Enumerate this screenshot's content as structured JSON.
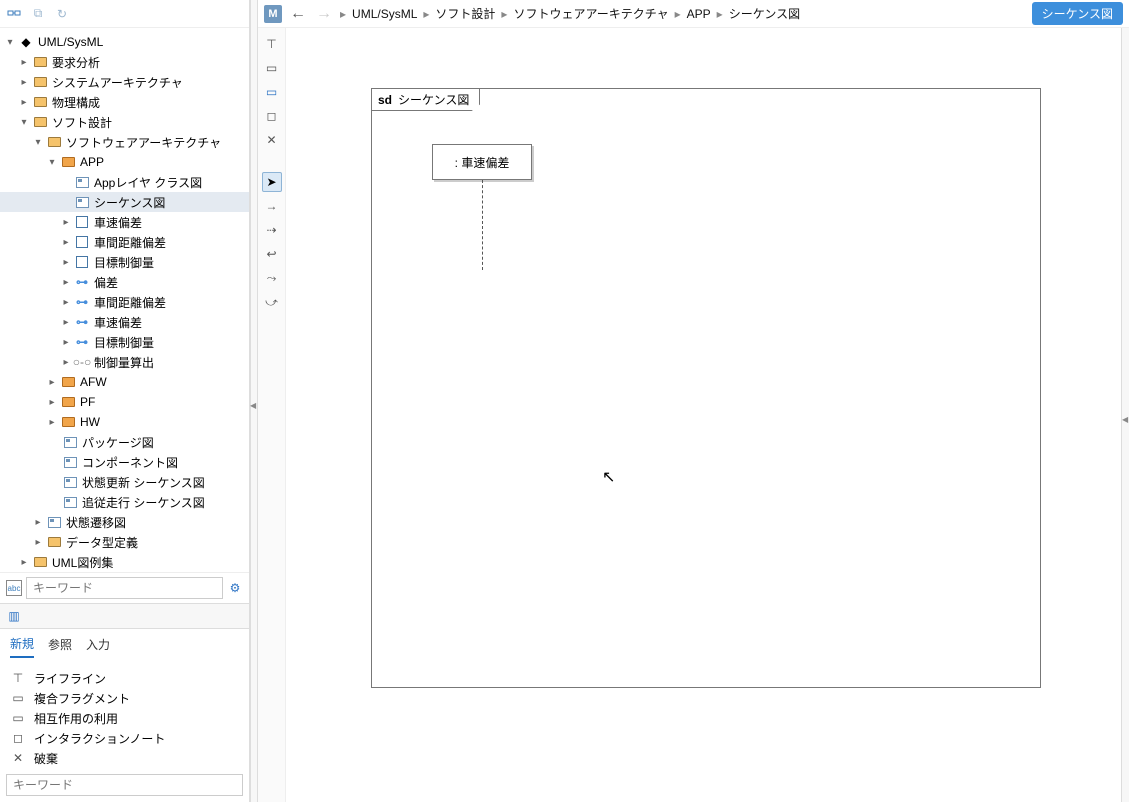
{
  "toolbar": {
    "model_badge": "M"
  },
  "breadcrumb": {
    "items": [
      "UML/SysML",
      "ソフト設計",
      "ソフトウェアアーキテクチャ",
      "APP",
      "シーケンス図"
    ],
    "chip": "シーケンス図"
  },
  "tree": {
    "root": "UML/SysML",
    "requirements": "要求分析",
    "sysarch": "システムアーキテクチャ",
    "physical": "物理構成",
    "softdesign": "ソフト設計",
    "softarch": "ソフトウェアアーキテクチャ",
    "app": "APP",
    "app_class": "Appレイヤ クラス図",
    "app_seq": "シーケンス図",
    "speed_dev": "車速偏差",
    "gap_dev": "車間距離偏差",
    "target_ctrl": "目標制御量",
    "dev": "偏差",
    "gap_dev2": "車間距離偏差",
    "speed_dev2": "車速偏差",
    "target_ctrl2": "目標制御量",
    "ctrl_calc": "制御量算出",
    "afw": "AFW",
    "pf": "PF",
    "hw": "HW",
    "pkg_diag": "パッケージ図",
    "comp_diag": "コンポーネント図",
    "state_upd_seq": "状態更新 シーケンス図",
    "follow_seq": "追従走行 シーケンス図",
    "state_trans": "状態遷移図",
    "datatype": "データ型定義",
    "examples": "UML図例集"
  },
  "search": {
    "placeholder": "キーワード"
  },
  "tabs": {
    "new": "新規",
    "ref": "参照",
    "input": "入力"
  },
  "palette": {
    "lifeline": "ライフライン",
    "combined": "複合フラグメント",
    "interaction_use": "相互作用の利用",
    "note": "インタラクションノート",
    "destroy": "破棄"
  },
  "filter": {
    "placeholder": "キーワード"
  },
  "diagram": {
    "frame_kw": "sd",
    "frame_title": "シーケンス図",
    "lifeline1": ": 車速偏差"
  }
}
